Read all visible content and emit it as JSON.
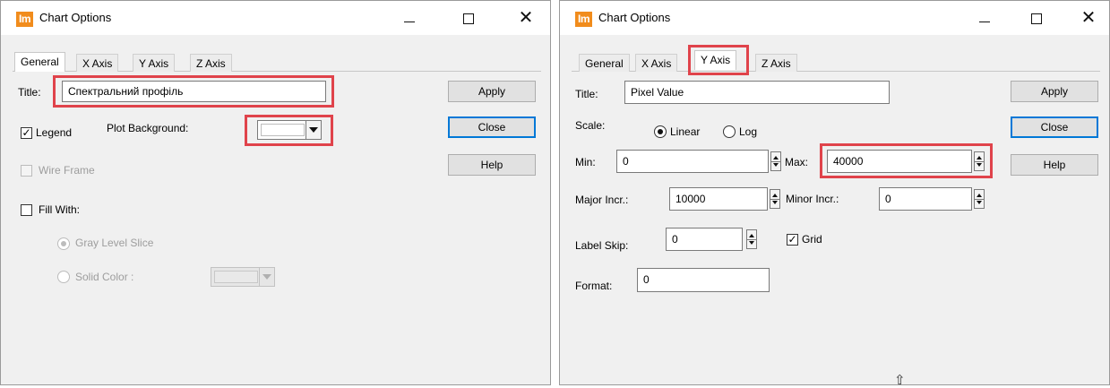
{
  "left_window": {
    "title": "Chart Options",
    "app_icon": "Im",
    "tabs": [
      "General",
      "X Axis",
      "Y Axis",
      "Z Axis"
    ],
    "active_tab": "General",
    "title_label": "Title:",
    "title_value": "Спектральний профіль",
    "legend_label": "Legend",
    "legend_checked": true,
    "plot_bg_label": "Plot Background:",
    "plot_bg_color": "#ffffff",
    "wire_frame_label": "Wire Frame",
    "fill_with_label": "Fill With:",
    "gray_slice_label": "Gray Level Slice",
    "solid_color_label": "Solid Color :",
    "buttons": {
      "apply": "Apply",
      "close": "Close",
      "help": "Help"
    }
  },
  "right_window": {
    "title": "Chart Options",
    "app_icon": "Im",
    "tabs": [
      "General",
      "X Axis",
      "Y Axis",
      "Z Axis"
    ],
    "active_tab": "Y Axis",
    "title_label": "Title:",
    "title_value": "Pixel Value",
    "scale_label": "Scale:",
    "linear_label": "Linear",
    "log_label": "Log",
    "scale_selected": "Linear",
    "min_label": "Min:",
    "min_value": "0",
    "max_label": "Max:",
    "max_value": "40000",
    "major_label": "Major Incr.:",
    "major_value": "10000",
    "minor_label": "Minor Incr.:",
    "minor_value": "0",
    "label_skip_label": "Label Skip:",
    "label_skip_value": "0",
    "grid_label": "Grid",
    "grid_checked": true,
    "format_label": "Format:",
    "format_value": "0",
    "buttons": {
      "apply": "Apply",
      "close": "Close",
      "help": "Help"
    }
  },
  "window_controls": {
    "minimize_icon": "minimize-icon",
    "maximize_icon": "maximize-icon",
    "close_icon": "close-icon"
  },
  "highlight_color": "#e0434b",
  "app_icon_color": "#f18c1c"
}
